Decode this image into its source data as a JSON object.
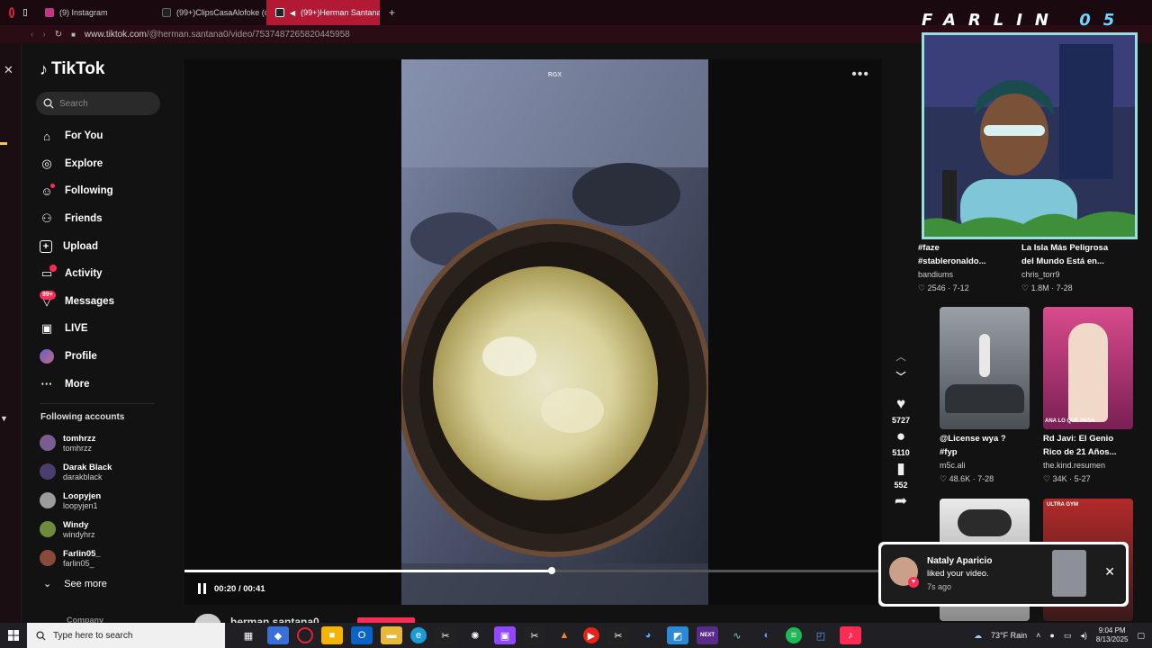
{
  "browser": {
    "tabs": [
      {
        "label": "(9) Instagram",
        "color": "#c13584"
      },
      {
        "label": "(99+)ClipsCasaAlofoke (c",
        "color": "#222222"
      },
      {
        "label": "(99+)Herman Santana",
        "color": "#222222"
      }
    ],
    "new_tab": "+",
    "url_host": "www.tiktok.com",
    "url_path": "/@herman.santana0/video/7537487265820445958"
  },
  "tiktok": {
    "brand": "TikTok",
    "search_placeholder": "Search",
    "nav": [
      {
        "label": "For You",
        "icon": "home-icon"
      },
      {
        "label": "Explore",
        "icon": "compass-icon"
      },
      {
        "label": "Following",
        "icon": "following-icon"
      },
      {
        "label": "Friends",
        "icon": "friends-icon"
      },
      {
        "label": "Upload",
        "icon": "upload-icon"
      },
      {
        "label": "Activity",
        "icon": "activity-icon"
      },
      {
        "label": "Messages",
        "icon": "messages-icon",
        "badge": "99+"
      },
      {
        "label": "LIVE",
        "icon": "live-icon"
      },
      {
        "label": "Profile",
        "icon": "profile-icon"
      },
      {
        "label": "More",
        "icon": "more-icon"
      }
    ],
    "following_title": "Following accounts",
    "following": [
      {
        "name": "tomhrzz",
        "handle": "tomhrzz",
        "color": "#7a5c8e"
      },
      {
        "name": "Darak Black",
        "handle": "darakblack",
        "color": "#4b3d6d"
      },
      {
        "name": "Loopyjen",
        "handle": "loopyjen1",
        "color": "#9b9b9b"
      },
      {
        "name": "Windy",
        "handle": "windyhrz",
        "color": "#6e8b3d"
      },
      {
        "name": "Farlin05_",
        "handle": "farlin05_",
        "color": "#8a4a3a"
      }
    ],
    "see_more": "See more",
    "company": "Company"
  },
  "video": {
    "label": "RGX",
    "time_current": "00:20",
    "time_total": "00:41",
    "progress": 0.527,
    "author": "herman.santana0",
    "likes": "5727",
    "comments": "5110",
    "saves": "552"
  },
  "recommended": [
    {
      "title1": "#faze",
      "title2": "#stableronaldo...",
      "user": "bandiums",
      "stats": "♡ 2546 · 7-12"
    },
    {
      "title1": "La Isla Más Peligrosa",
      "title2": "del Mundo Está en...",
      "user": "chris_torr9",
      "stats": "♡ 1.8M · 7-28"
    },
    {
      "title1": "@License wya ?",
      "title2": "#fyp",
      "user": "m5c.ali",
      "stats": "♡ 48.6K · 7-28"
    },
    {
      "title1": "Rd Javi: El Genio",
      "title2": "Rico de 21 Años...",
      "user": "the.kind.resumen",
      "stats": "♡ 34K · 5-27"
    }
  ],
  "thumb_labels": {
    "second": "ANA LO QUE PASA",
    "ultra": "ULTRA GYM"
  },
  "overlay": {
    "brand_a": "FARLIN",
    "brand_b": "05"
  },
  "notification": {
    "name": "Nataly Aparicio",
    "message": "liked your video.",
    "time": "7s ago"
  },
  "taskbar": {
    "search_placeholder": "Type here to search",
    "weather": "73°F  Rain",
    "time": "9:04 PM",
    "date": "8/13/2025"
  }
}
